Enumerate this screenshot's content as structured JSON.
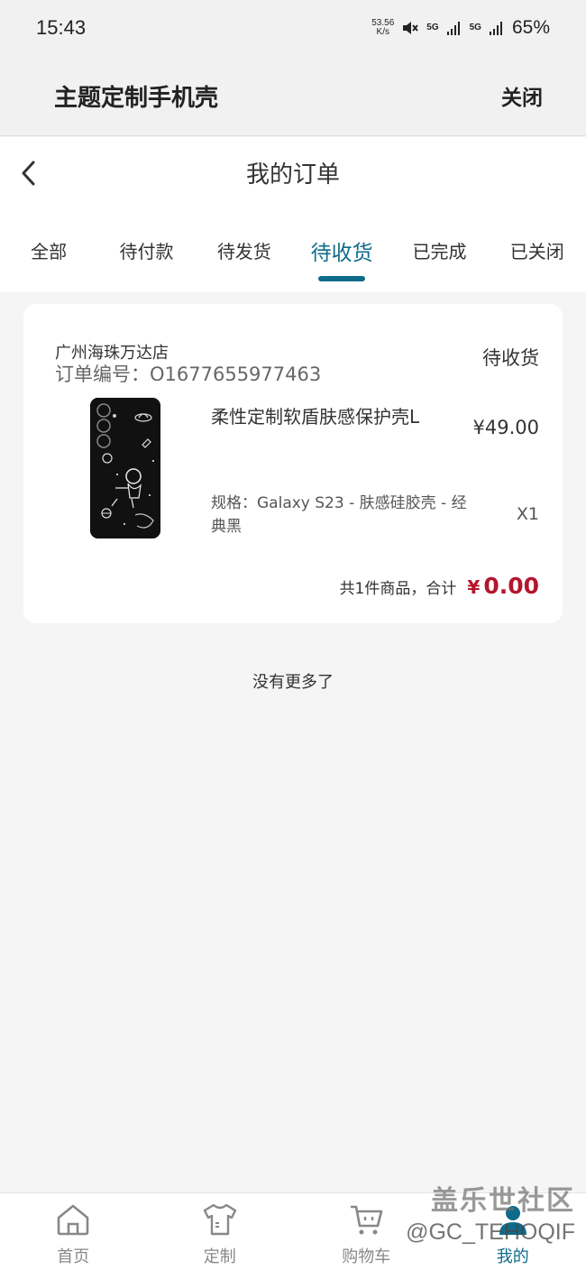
{
  "status_bar": {
    "time": "15:43",
    "net_speed_value": "53.56",
    "net_speed_unit": "K/s",
    "signal1": "5G",
    "signal2": "5G",
    "battery": "65%"
  },
  "mini_program": {
    "title": "主题定制手机壳",
    "close_label": "关闭"
  },
  "page": {
    "title": "我的订单"
  },
  "tabs": [
    {
      "label": "全部",
      "active": false
    },
    {
      "label": "待付款",
      "active": false
    },
    {
      "label": "待发货",
      "active": false
    },
    {
      "label": "待收货",
      "active": true
    },
    {
      "label": "已完成",
      "active": false
    },
    {
      "label": "已关闭",
      "active": false
    }
  ],
  "order": {
    "store": "广州海珠万达店",
    "order_no": "订单编号：O1677655977463",
    "status": "待收货",
    "product": {
      "name": "柔性定制软盾肤感保护壳L",
      "price": "¥49.00",
      "spec": "规格：Galaxy S23 - 肤感硅胶壳 - 经典黑",
      "qty": "X1"
    },
    "total_label": "共1件商品，合计",
    "total_currency": "¥",
    "total_amount": "0.00"
  },
  "no_more": "没有更多了",
  "bottom_nav": [
    {
      "label": "首页",
      "icon": "home-icon",
      "active": false
    },
    {
      "label": "定制",
      "icon": "tshirt-icon",
      "active": false
    },
    {
      "label": "购物车",
      "icon": "cart-icon",
      "active": false
    },
    {
      "label": "我的",
      "icon": "user-icon",
      "active": true
    }
  ],
  "watermark": {
    "line1": "盖乐世社区",
    "line2": "@GC_TEHOQIF"
  },
  "colors": {
    "accent": "#0f6b8a",
    "price_red": "#b4162d",
    "background": "#f5f5f5"
  }
}
